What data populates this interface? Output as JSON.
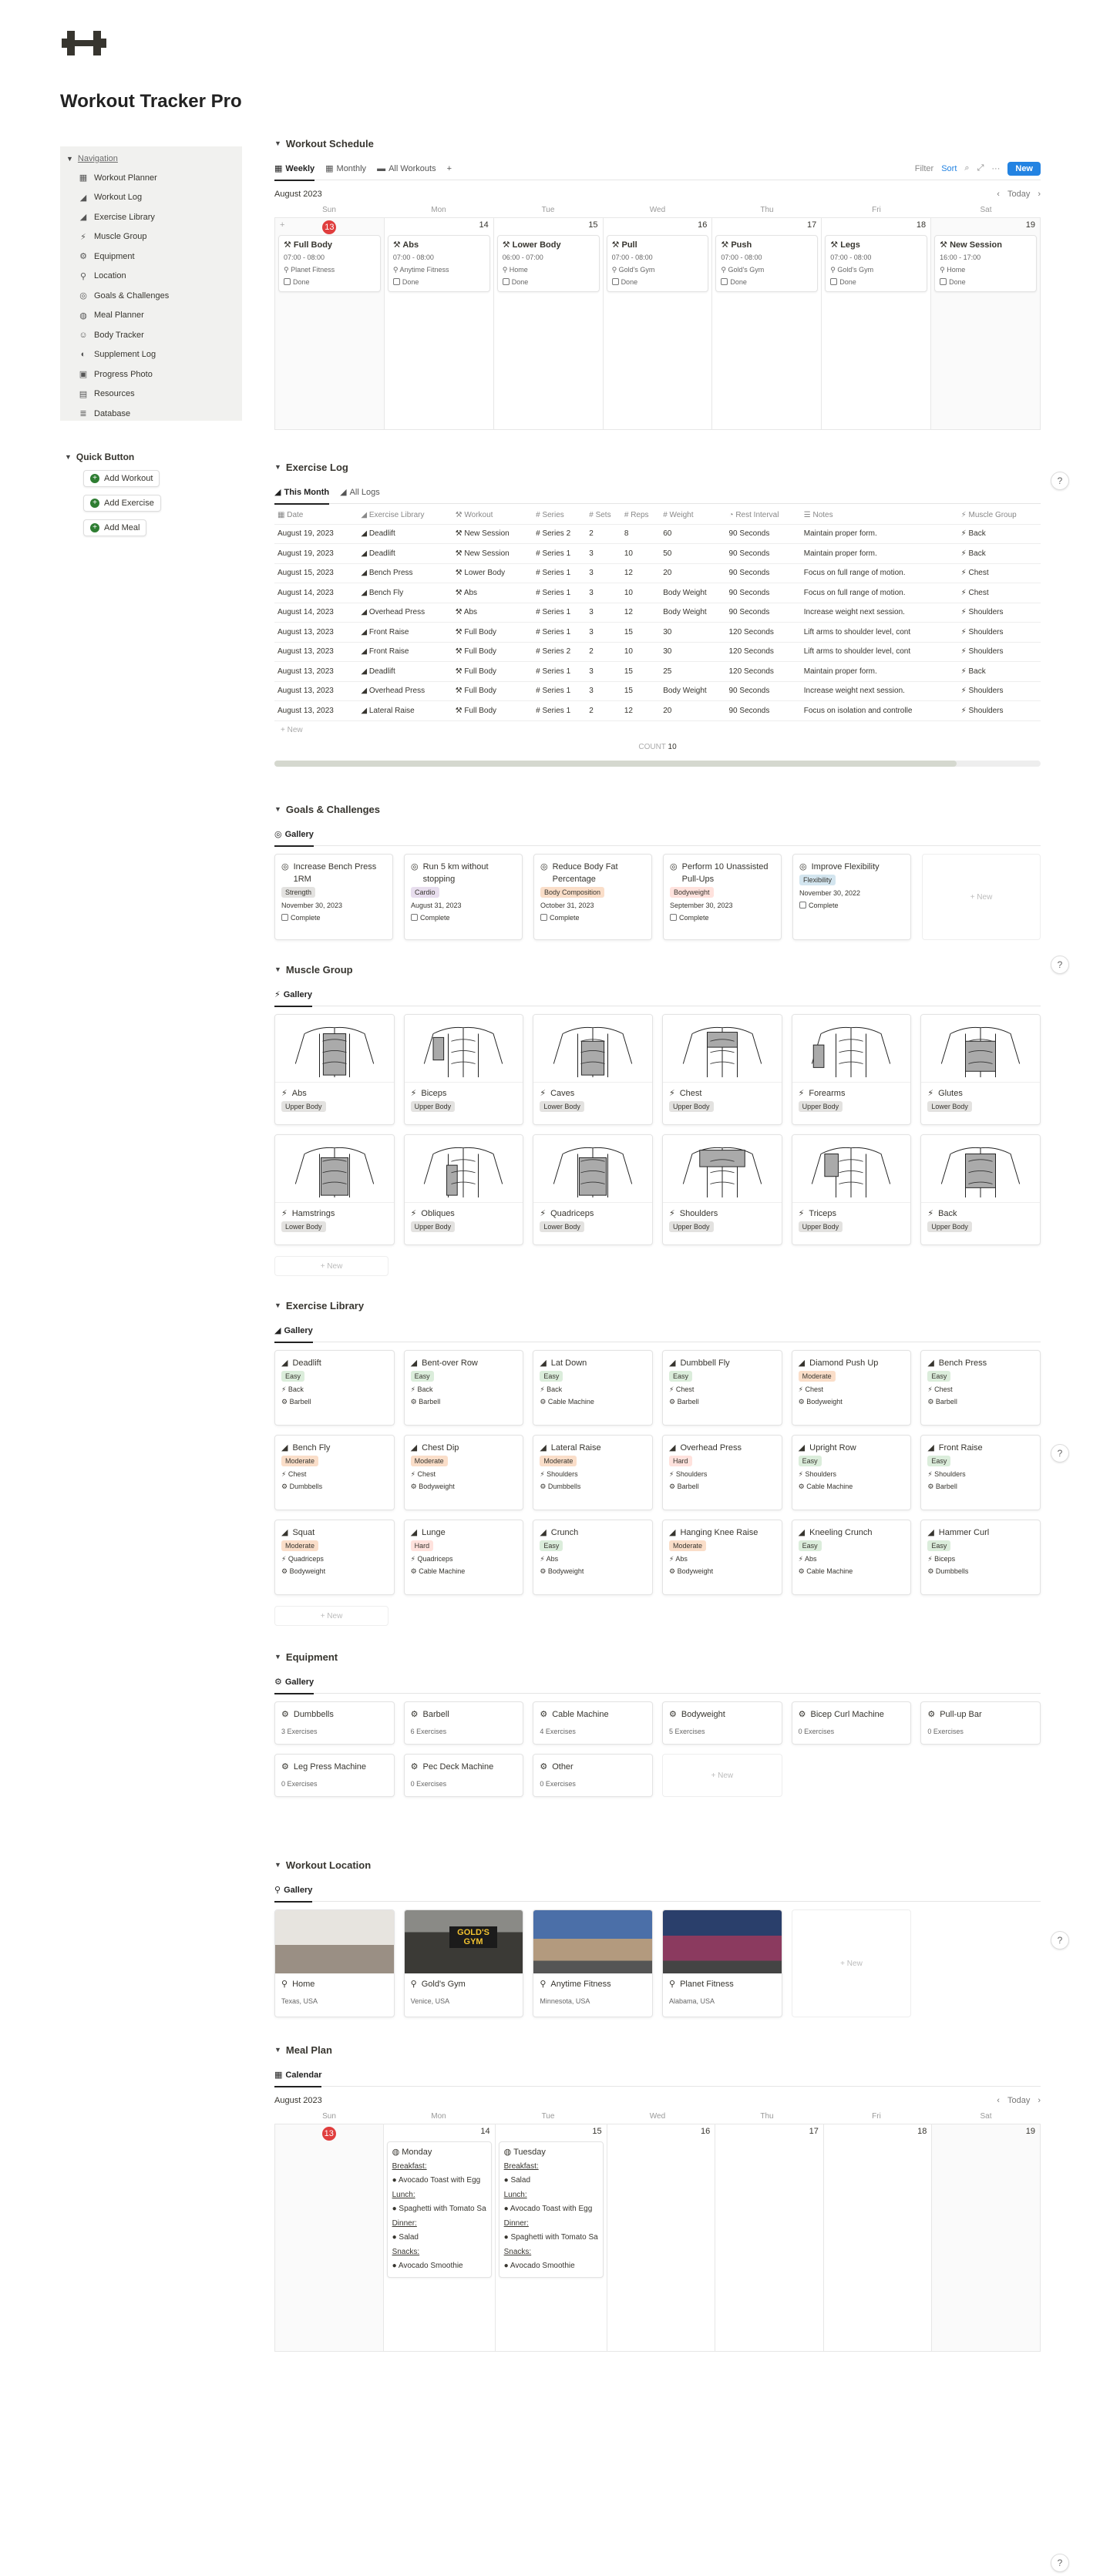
{
  "page": {
    "title": "Workout Tracker Pro"
  },
  "sidebar": {
    "heading": "Navigation",
    "items": [
      {
        "label": "Workout Planner",
        "icon": "calendar-icon"
      },
      {
        "label": "Workout Log",
        "icon": "chart-icon"
      },
      {
        "label": "Exercise Library",
        "icon": "chart-icon"
      },
      {
        "label": "Muscle Group",
        "icon": "bolt-icon"
      },
      {
        "label": "Equipment",
        "icon": "gear-icon"
      },
      {
        "label": "Location",
        "icon": "pin-icon"
      },
      {
        "label": "Goals & Challenges",
        "icon": "target-icon"
      },
      {
        "label": "Meal Planner",
        "icon": "meal-icon"
      },
      {
        "label": "Body Tracker",
        "icon": "person-icon"
      },
      {
        "label": "Supplement Log",
        "icon": "pill-icon"
      },
      {
        "label": "Progress Photo",
        "icon": "photo-icon"
      },
      {
        "label": "Resources",
        "icon": "book-icon"
      },
      {
        "label": "Database",
        "icon": "db-icon"
      }
    ]
  },
  "quick": {
    "heading": "Quick Button",
    "buttons": [
      "Add Workout",
      "Add Exercise",
      "Add Meal"
    ]
  },
  "schedule": {
    "title": "Workout Schedule",
    "tabs": [
      "Weekly",
      "Monthly",
      "All Workouts"
    ],
    "filter": "Filter",
    "sort": "Sort",
    "new": "New",
    "month": "August 2023",
    "today": "Today",
    "dow": [
      "Sun",
      "Mon",
      "Tue",
      "Wed",
      "Thu",
      "Fri",
      "Sat"
    ],
    "days": [
      "",
      "13",
      "14",
      "15",
      "16",
      "17",
      "18",
      "19"
    ],
    "events": [
      {
        "title": "Full Body",
        "time": "07:00 - 08:00",
        "place": "Planet Fitness",
        "done": "Done"
      },
      {
        "title": "Abs",
        "time": "07:00 - 08:00",
        "place": "Anytime Fitness",
        "done": "Done"
      },
      {
        "title": "Lower Body",
        "time": "06:00 - 07:00",
        "place": "Home",
        "done": "Done"
      },
      {
        "title": "Pull",
        "time": "07:00 - 08:00",
        "place": "Gold's Gym",
        "done": "Done"
      },
      {
        "title": "Push",
        "time": "07:00 - 08:00",
        "place": "Gold's Gym",
        "done": "Done"
      },
      {
        "title": "Legs",
        "time": "07:00 - 08:00",
        "place": "Gold's Gym",
        "done": "Done"
      },
      {
        "title": "New Session",
        "time": "16:00 - 17:00",
        "place": "Home",
        "done": "Done"
      }
    ]
  },
  "log": {
    "title": "Exercise Log",
    "tabs": [
      "This Month",
      "All Logs"
    ],
    "columns": [
      "Date",
      "Exercise Library",
      "Workout",
      "Series",
      "Sets",
      "Reps",
      "Weight",
      "Rest Interval",
      "Notes",
      "Muscle Group"
    ],
    "rows": [
      [
        "August 19, 2023",
        "Deadlift",
        "New Session",
        "Series 2",
        "2",
        "8",
        "60",
        "90 Seconds",
        "Maintain proper form.",
        "Back"
      ],
      [
        "August 19, 2023",
        "Deadlift",
        "New Session",
        "Series 1",
        "3",
        "10",
        "50",
        "90 Seconds",
        "Maintain proper form.",
        "Back"
      ],
      [
        "August 15, 2023",
        "Bench Press",
        "Lower Body",
        "Series 1",
        "3",
        "12",
        "20",
        "90 Seconds",
        "Focus on full range of motion.",
        "Chest"
      ],
      [
        "August 14, 2023",
        "Bench Fly",
        "Abs",
        "Series 1",
        "3",
        "10",
        "Body Weight",
        "90 Seconds",
        "Focus on full range of motion.",
        "Chest"
      ],
      [
        "August 14, 2023",
        "Overhead Press",
        "Abs",
        "Series 1",
        "3",
        "12",
        "Body Weight",
        "90 Seconds",
        "Increase weight next session.",
        "Shoulders"
      ],
      [
        "August 13, 2023",
        "Front Raise",
        "Full Body",
        "Series 1",
        "3",
        "15",
        "30",
        "120 Seconds",
        "Lift arms to shoulder level, cont",
        "Shoulders"
      ],
      [
        "August 13, 2023",
        "Front Raise",
        "Full Body",
        "Series 2",
        "2",
        "10",
        "30",
        "120 Seconds",
        "Lift arms to shoulder level, cont",
        "Shoulders"
      ],
      [
        "August 13, 2023",
        "Deadlift",
        "Full Body",
        "Series 1",
        "3",
        "15",
        "25",
        "120 Seconds",
        "Maintain proper form.",
        "Back"
      ],
      [
        "August 13, 2023",
        "Overhead Press",
        "Full Body",
        "Series 1",
        "3",
        "15",
        "Body Weight",
        "90 Seconds",
        "Increase weight next session.",
        "Shoulders"
      ],
      [
        "August 13, 2023",
        "Lateral Raise",
        "Full Body",
        "Series 1",
        "2",
        "12",
        "20",
        "90 Seconds",
        "Focus on isolation and controlle",
        "Shoulders"
      ]
    ],
    "new": "+ New",
    "count_label": "COUNT",
    "count": "10",
    "scroll_fraction": 0.89
  },
  "goals": {
    "title": "Goals & Challenges",
    "tab": "Gallery",
    "complete": "Complete",
    "new": "+ New",
    "items": [
      {
        "title": "Increase Bench Press 1RM",
        "tag": "Strength",
        "tagColor": "#e3e2e0",
        "date": "November 30, 2023"
      },
      {
        "title": "Run 5 km without stopping",
        "tag": "Cardio",
        "tagColor": "#e8deee",
        "date": "August 31, 2023"
      },
      {
        "title": "Reduce Body Fat Percentage",
        "tag": "Body Composition",
        "tagColor": "#fadec9",
        "date": "October 31, 2023"
      },
      {
        "title": "Perform 10 Unassisted Pull-Ups",
        "tag": "Bodyweight",
        "tagColor": "#ffe2dd",
        "date": "September 30, 2023"
      },
      {
        "title": "Improve Flexibility",
        "tag": "Flexibility",
        "tagColor": "#d3e5ef",
        "date": "November 30, 2022"
      }
    ]
  },
  "muscles": {
    "title": "Muscle Group",
    "tab": "Gallery",
    "new": "+ New",
    "items": [
      {
        "name": "Abs",
        "region": "Upper Body"
      },
      {
        "name": "Biceps",
        "region": "Upper Body"
      },
      {
        "name": "Caves",
        "region": "Lower Body"
      },
      {
        "name": "Chest",
        "region": "Upper Body"
      },
      {
        "name": "Forearms",
        "region": "Upper Body"
      },
      {
        "name": "Glutes",
        "region": "Lower Body"
      },
      {
        "name": "Hamstrings",
        "region": "Lower Body"
      },
      {
        "name": "Obliques",
        "region": "Upper Body"
      },
      {
        "name": "Quadriceps",
        "region": "Lower Body"
      },
      {
        "name": "Shoulders",
        "region": "Upper Body"
      },
      {
        "name": "Triceps",
        "region": "Upper Body"
      },
      {
        "name": "Back",
        "region": "Upper Body"
      }
    ]
  },
  "library": {
    "title": "Exercise Library",
    "tab": "Gallery",
    "new": "+ New",
    "items": [
      {
        "name": "Deadlift",
        "level": "Easy",
        "muscle": "Back",
        "equip": "Barbell"
      },
      {
        "name": "Bent-over Row",
        "level": "Easy",
        "muscle": "Back",
        "equip": "Barbell"
      },
      {
        "name": "Lat Down",
        "level": "Easy",
        "muscle": "Back",
        "equip": "Cable Machine"
      },
      {
        "name": "Dumbbell Fly",
        "level": "Easy",
        "muscle": "Chest",
        "equip": "Barbell"
      },
      {
        "name": "Diamond Push Up",
        "level": "Moderate",
        "muscle": "Chest",
        "equip": "Bodyweight"
      },
      {
        "name": "Bench Press",
        "level": "Easy",
        "muscle": "Chest",
        "equip": "Barbell"
      },
      {
        "name": "Bench Fly",
        "level": "Moderate",
        "muscle": "Chest",
        "equip": "Dumbbells"
      },
      {
        "name": "Chest Dip",
        "level": "Moderate",
        "muscle": "Chest",
        "equip": "Bodyweight"
      },
      {
        "name": "Lateral Raise",
        "level": "Moderate",
        "muscle": "Shoulders",
        "equip": "Dumbbells"
      },
      {
        "name": "Overhead Press",
        "level": "Hard",
        "muscle": "Shoulders",
        "equip": "Barbell"
      },
      {
        "name": "Upright Row",
        "level": "Easy",
        "muscle": "Shoulders",
        "equip": "Cable Machine"
      },
      {
        "name": "Front Raise",
        "level": "Easy",
        "muscle": "Shoulders",
        "equip": "Barbell"
      },
      {
        "name": "Squat",
        "level": "Moderate",
        "muscle": "Quadriceps",
        "equip": "Bodyweight"
      },
      {
        "name": "Lunge",
        "level": "Hard",
        "muscle": "Quadriceps",
        "equip": "Cable Machine"
      },
      {
        "name": "Crunch",
        "level": "Easy",
        "muscle": "Abs",
        "equip": "Bodyweight"
      },
      {
        "name": "Hanging Knee Raise",
        "level": "Moderate",
        "muscle": "Abs",
        "equip": "Bodyweight"
      },
      {
        "name": "Kneeling Crunch",
        "level": "Easy",
        "muscle": "Abs",
        "equip": "Cable Machine"
      },
      {
        "name": "Hammer Curl",
        "level": "Easy",
        "muscle": "Biceps",
        "equip": "Dumbbells"
      }
    ],
    "levelColors": {
      "Easy": "#dbeddb",
      "Moderate": "#fadec9",
      "Hard": "#ffe2dd"
    }
  },
  "equipment": {
    "title": "Equipment",
    "tab": "Gallery",
    "new": "+ New",
    "items": [
      {
        "name": "Dumbbells",
        "count": "3 Exercises"
      },
      {
        "name": "Barbell",
        "count": "6 Exercises"
      },
      {
        "name": "Cable Machine",
        "count": "4 Exercises"
      },
      {
        "name": "Bodyweight",
        "count": "5 Exercises"
      },
      {
        "name": "Bicep Curl Machine",
        "count": "0 Exercises"
      },
      {
        "name": "Pull-up Bar",
        "count": "0 Exercises"
      },
      {
        "name": "Leg Press Machine",
        "count": "0 Exercises"
      },
      {
        "name": "Pec Deck Machine",
        "count": "0 Exercises"
      },
      {
        "name": "Other",
        "count": "0 Exercises"
      }
    ]
  },
  "locations": {
    "title": "Workout Location",
    "tab": "Gallery",
    "new": "+ New",
    "items": [
      {
        "name": "Home",
        "where": "Texas, USA"
      },
      {
        "name": "Gold's Gym",
        "where": "Venice, USA",
        "sign": "GOLD'S GYM"
      },
      {
        "name": "Anytime Fitness",
        "where": "Minnesota, USA"
      },
      {
        "name": "Planet Fitness",
        "where": "Alabama, USA"
      }
    ]
  },
  "meals": {
    "title": "Meal Plan",
    "tab": "Calendar",
    "month": "August 2023",
    "today": "Today",
    "days": [
      {
        "day": "Monday",
        "breakfast": "Avocado Toast with Egg",
        "lunch": "Spaghetti with Tomato Sa",
        "dinner": "Salad",
        "snacks": "Avocado Smoothie"
      },
      {
        "day": "Tuesday",
        "breakfast": "Salad",
        "lunch": "Avocado Toast with Egg",
        "dinner": "Spaghetti with Tomato Sa",
        "snacks": "Avocado Smoothie"
      }
    ],
    "labels": {
      "breakfast": "Breakfast:",
      "lunch": "Lunch:",
      "dinner": "Dinner:",
      "snacks": "Snacks:"
    }
  },
  "help": "?"
}
